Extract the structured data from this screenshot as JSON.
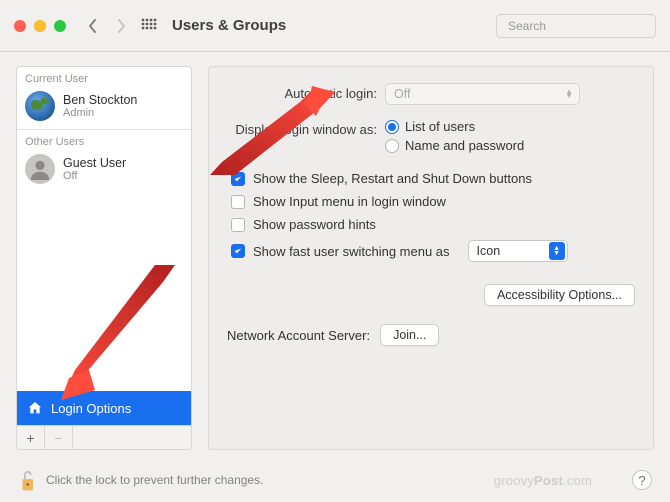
{
  "header": {
    "title": "Users & Groups",
    "search_placeholder": "Search"
  },
  "sidebar": {
    "sections": [
      {
        "label": "Current User",
        "users": [
          {
            "name": "Ben Stockton",
            "role": "Admin"
          }
        ]
      },
      {
        "label": "Other Users",
        "users": [
          {
            "name": "Guest User",
            "role": "Off"
          }
        ]
      }
    ],
    "login_options_label": "Login Options",
    "add_button": "+",
    "remove_button": "−"
  },
  "main": {
    "auto_login_label": "Automatic login:",
    "auto_login_value": "Off",
    "display_label": "Display login window as:",
    "radios": {
      "list": "List of users",
      "namepw": "Name and password"
    },
    "checks": {
      "sleep": "Show the Sleep, Restart and Shut Down buttons",
      "input": "Show Input menu in login window",
      "hints": "Show password hints",
      "fast": "Show fast user switching menu as"
    },
    "fast_value": "Icon",
    "accessibility_btn": "Accessibility Options...",
    "network_label": "Network Account Server:",
    "join_btn": "Join..."
  },
  "footer": {
    "lock_text": "Click the lock to prevent further changes.",
    "watermark_a": "groovy",
    "watermark_b": "Post",
    "watermark_c": ".com"
  }
}
